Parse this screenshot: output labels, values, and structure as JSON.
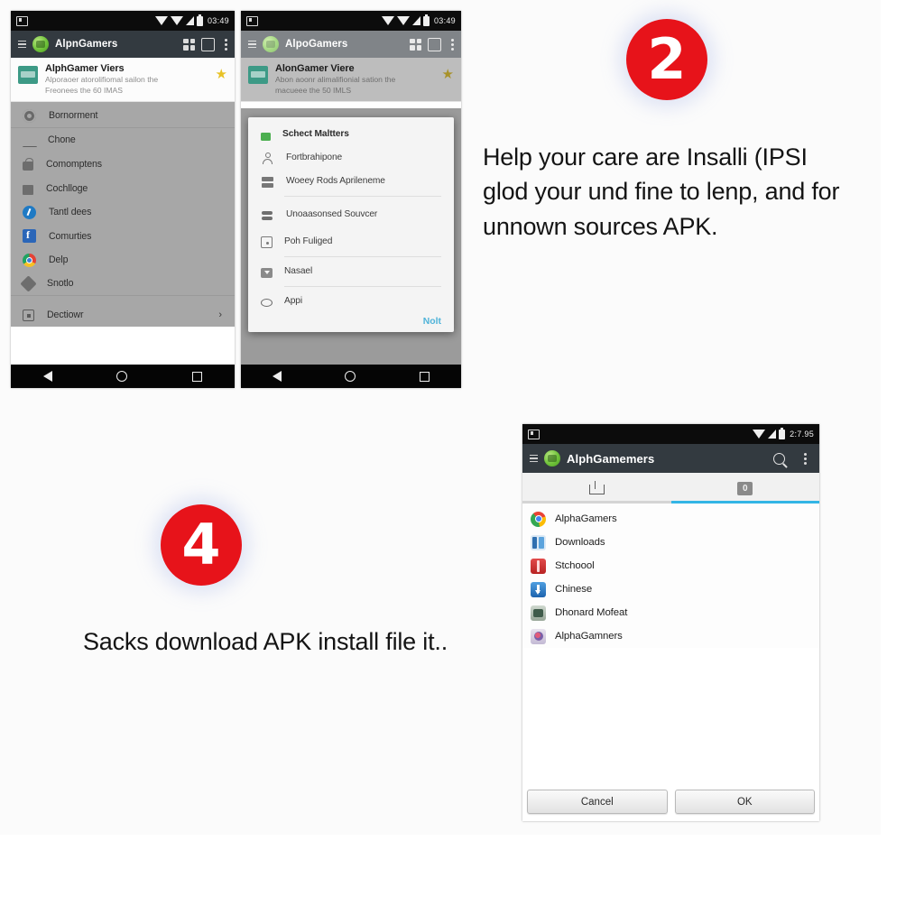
{
  "theme": {
    "badge_color": "#e7131a",
    "accent_blue": "#33b5e5",
    "appbar_color": "#333a40",
    "drawer_color": "#a7a7a7",
    "link_color": "#4fb3d9"
  },
  "phone1": {
    "status": {
      "time": "03:49"
    },
    "appbar": {
      "title": "AlpnGamers"
    },
    "app_card": {
      "title": "AlphGamer Viers",
      "subtitle_line1": "Alporaoer atorolifiomal sailon the",
      "subtitle_line2": "Freonees the 60 IMAS",
      "star": "★"
    },
    "drawer_items": [
      {
        "label": "Bornorment",
        "icon": "settings-icon"
      },
      {
        "label": "Chone",
        "icon": "shield-icon"
      },
      {
        "label": "Comomptens",
        "icon": "lock-icon"
      },
      {
        "label": "Cochlloge",
        "icon": "briefcase-icon"
      },
      {
        "label": "Tantl dees",
        "icon": "info-circle-icon"
      },
      {
        "label": "Comurties",
        "icon": "facebook-icon"
      },
      {
        "label": "Delp",
        "icon": "chrome-icon"
      },
      {
        "label": "Snotlo",
        "icon": "diamond-icon"
      },
      {
        "label": "Dectiowr",
        "icon": "square-dot-icon",
        "chevron": "›"
      }
    ],
    "navbar": {
      "back": "back-icon",
      "home": "home-icon",
      "recents": "recents-icon"
    }
  },
  "phone2": {
    "status": {
      "time": "03:49"
    },
    "appbar": {
      "title": "AlpoGamers"
    },
    "app_card": {
      "title": "AlonGamer Viere",
      "subtitle_line1": "Abon aoonr alimalifionial sation the",
      "subtitle_line2": "macueee the 50 IMLS",
      "star": "★"
    },
    "dialog": {
      "items": [
        {
          "label": "Schect Maltters",
          "icon": "green-lock-icon"
        },
        {
          "label": "Fortbrahipone",
          "icon": "person-icon"
        },
        {
          "label": "Woeey Rods Aprileneme",
          "icon": "apps-icon"
        },
        {
          "label": "Unoaasonsed Souvcer",
          "icon": "stack-icon"
        },
        {
          "label": "Poh Fuliged",
          "icon": "box-dot-icon"
        },
        {
          "label": "Nasael",
          "icon": "download-icon"
        },
        {
          "label": "Appi",
          "icon": "oval-icon"
        }
      ],
      "action_label": "Nolt"
    },
    "navbar": {
      "back": "back-icon",
      "home": "home-icon",
      "recents": "recents-icon"
    }
  },
  "step2": {
    "number": "2",
    "text": "Help your care are Insalli (IPSI glod your und fine to lenp, and for unnown sources APK."
  },
  "step4": {
    "number": "4",
    "text": "Sacks download APK install file it.."
  },
  "phone4": {
    "status": {
      "time": "2:7.95"
    },
    "appbar": {
      "title": "AlphGamemers"
    },
    "tabs": [
      {
        "icon": "folder-up-icon",
        "active": false
      },
      {
        "icon": "sdcard-icon",
        "label": "0",
        "active": true
      }
    ],
    "files": [
      {
        "label": "AlphaGamers",
        "icon": "chrome-icon"
      },
      {
        "label": "Downloads",
        "icon": "downloads-icon"
      },
      {
        "label": "Stchoool",
        "icon": "red-app-icon"
      },
      {
        "label": "Chinese",
        "icon": "blue-download-icon"
      },
      {
        "label": "Dhonard Mofeat",
        "icon": "grey-app-icon"
      },
      {
        "label": "AlphaGamners",
        "icon": "flower-app-icon"
      }
    ],
    "buttons": {
      "cancel": "Cancel",
      "ok": "OK"
    }
  }
}
